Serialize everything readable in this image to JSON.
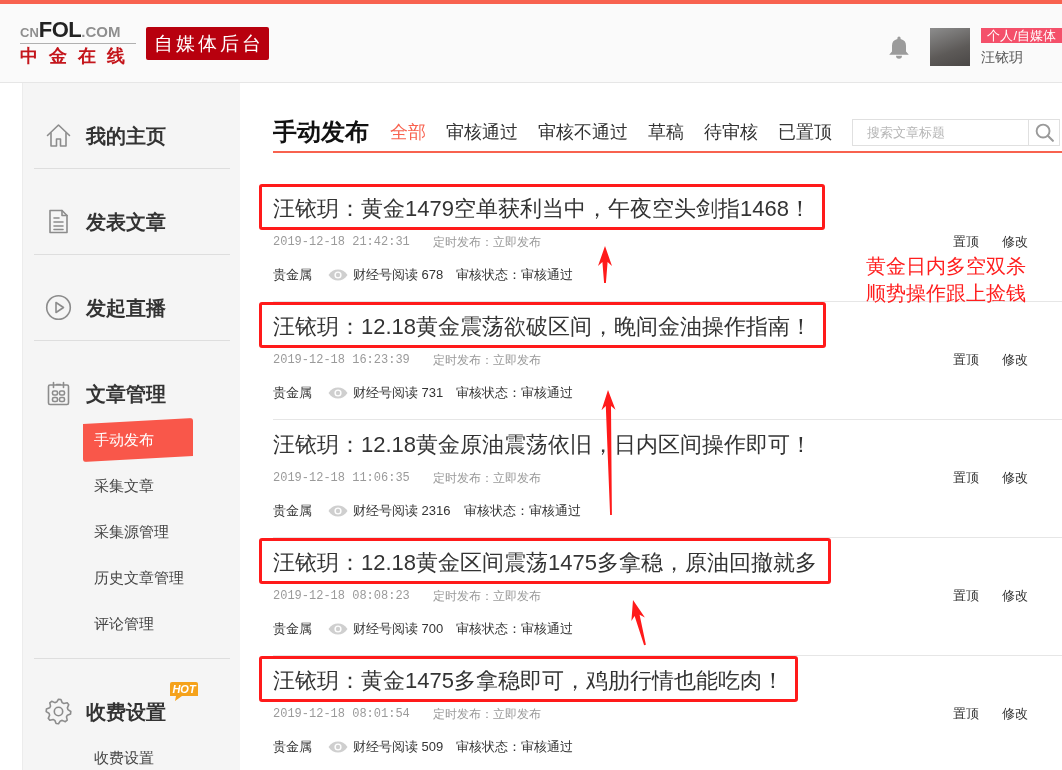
{
  "header": {
    "logo": {
      "wordmark": [
        "CN",
        "FOL",
        ".COM"
      ],
      "name": "中金在线"
    },
    "site_label": "自媒体后台",
    "account": {
      "badge": "个人/自媒体",
      "name": "汪铱玥"
    }
  },
  "sidebar": {
    "items": [
      {
        "label": "我的主页"
      },
      {
        "label": "发表文章"
      },
      {
        "label": "发起直播"
      },
      {
        "label": "文章管理",
        "children": [
          {
            "label": "手动发布",
            "selected": true
          },
          {
            "label": "采集文章",
            "selected": false
          },
          {
            "label": "采集源管理",
            "selected": false
          },
          {
            "label": "历史文章管理",
            "selected": false
          },
          {
            "label": "评论管理",
            "selected": false
          }
        ]
      },
      {
        "label": "收费设置",
        "badge": "HOT",
        "children": [
          {
            "label": "收费设置",
            "selected": false
          }
        ]
      }
    ]
  },
  "page_title": "手动发布",
  "tabs": [
    {
      "label": "全部",
      "selected": true
    },
    {
      "label": "审核通过",
      "selected": false
    },
    {
      "label": "审核不通过",
      "selected": false
    },
    {
      "label": "草稿",
      "selected": false
    },
    {
      "label": "待审核",
      "selected": false
    },
    {
      "label": "已置顶",
      "selected": false
    }
  ],
  "search": {
    "placeholder": "搜索文章标题"
  },
  "articles": [
    {
      "title": "汪铱玥：黄金1479空单获利当中，午夜空头剑指1468！",
      "annotated": true,
      "date": "2019-12-18 21:42:31",
      "schedule": "定时发布：立即发布",
      "actions": [
        "置顶",
        "修改"
      ],
      "category": "贵金属",
      "reads": "财经号阅读 678",
      "review": "审核状态：审核通过"
    },
    {
      "title": "汪铱玥：12.18黄金震荡欲破区间，晚间金油操作指南！",
      "annotated": true,
      "date": "2019-12-18 16:23:39",
      "schedule": "定时发布：立即发布",
      "actions": [
        "置顶",
        "修改"
      ],
      "category": "贵金属",
      "reads": "财经号阅读 731",
      "review": "审核状态：审核通过"
    },
    {
      "title": "汪铱玥：12.18黄金原油震荡依旧，日内区间操作即可！",
      "annotated": false,
      "date": "2019-12-18 11:06:35",
      "schedule": "定时发布：立即发布",
      "actions": [
        "置顶",
        "修改"
      ],
      "category": "贵金属",
      "reads": "财经号阅读 2316",
      "review": "审核状态：审核通过"
    },
    {
      "title": "汪铱玥：12.18黄金区间震荡1475多拿稳，原油回撤就多",
      "annotated": true,
      "date": "2019-12-18 08:08:23",
      "schedule": "定时发布：立即发布",
      "actions": [
        "置顶",
        "修改"
      ],
      "category": "贵金属",
      "reads": "财经号阅读 700",
      "review": "审核状态：审核通过"
    },
    {
      "title": "汪铱玥：黄金1475多拿稳即可，鸡肋行情也能吃肉！",
      "annotated": true,
      "date": "2019-12-18 08:01:54",
      "schedule": "定时发布：立即发布",
      "actions": [
        "置顶",
        "修改"
      ],
      "category": "贵金属",
      "reads": "财经号阅读 509",
      "review": "审核状态：审核通过"
    }
  ],
  "annotation_note": {
    "lines": [
      "黄金日内多空双杀",
      "顺势操作跟上捡钱"
    ]
  }
}
